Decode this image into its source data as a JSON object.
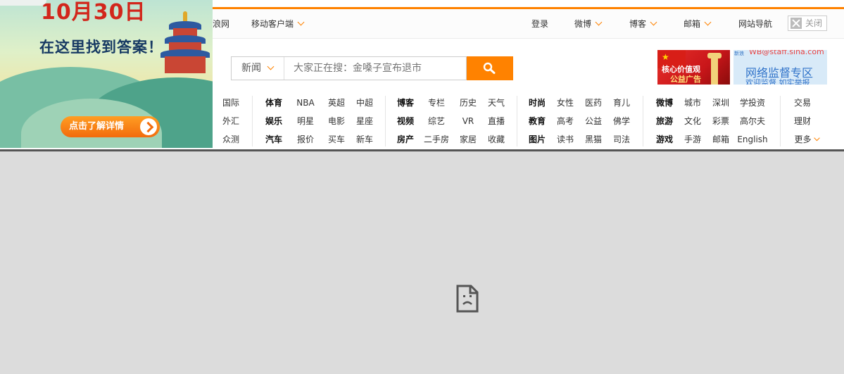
{
  "top_nav": {
    "site_partial": "浪网",
    "mobile_client": "移动客户端",
    "login": "登录",
    "weibo": "微博",
    "blog": "博客",
    "mail": "邮箱",
    "site_nav": "网站导航",
    "close": "关闭"
  },
  "search": {
    "category": "新闻",
    "placeholder": "大家正在搜：金嗓子宣布退市"
  },
  "ads": {
    "core_values_line1": "核心价值观",
    "core_values_line2": "公益广告",
    "monitor_email": "WB@staff.sina.com",
    "monitor_title": "网络监督专区",
    "monitor_sub": "欢迎监督 如实举报",
    "monitor_logo": "新浪"
  },
  "banner": {
    "title": "10月30日",
    "subtitle": "在这里找到答案！",
    "cta": "点击了解详情"
  },
  "link_groups": [
    {
      "col": [
        [
          "国际",
          "外汇",
          "众测"
        ]
      ]
    },
    {
      "cols": [
        [
          "体育",
          "娱乐",
          "汽车"
        ],
        [
          "NBA",
          "明星",
          "报价"
        ],
        [
          "英超",
          "电影",
          "买车"
        ],
        [
          "中超",
          "星座",
          "新车"
        ]
      ]
    },
    {
      "cols": [
        [
          "博客",
          "视频",
          "房产"
        ],
        [
          "专栏",
          "综艺",
          "二手房"
        ],
        [
          "历史",
          "VR",
          "家居"
        ],
        [
          "天气",
          "直播",
          "收藏"
        ]
      ]
    },
    {
      "cols": [
        [
          "时尚",
          "教育",
          "图片"
        ],
        [
          "女性",
          "高考",
          "读书"
        ],
        [
          "医药",
          "公益",
          "黑猫"
        ],
        [
          "育儿",
          "佛学",
          "司法"
        ]
      ]
    },
    {
      "cols": [
        [
          "微博",
          "旅游",
          "游戏"
        ],
        [
          "城市",
          "文化",
          "手游"
        ],
        [
          "深圳",
          "彩票",
          "邮箱"
        ],
        [
          "学投资",
          "高尔夫",
          "English"
        ]
      ]
    },
    {
      "col": [
        [
          "交易",
          "理财",
          "更多"
        ]
      ]
    }
  ],
  "links": {
    "g0": [
      "国际",
      "外汇",
      "众测"
    ],
    "g1c0": [
      "体育",
      "娱乐",
      "汽车"
    ],
    "g1c1": [
      "NBA",
      "明星",
      "报价"
    ],
    "g1c2": [
      "英超",
      "电影",
      "买车"
    ],
    "g1c3": [
      "中超",
      "星座",
      "新车"
    ],
    "g2c0": [
      "博客",
      "视频",
      "房产"
    ],
    "g2c1": [
      "专栏",
      "综艺",
      "二手房"
    ],
    "g2c2": [
      "历史",
      "VR",
      "家居"
    ],
    "g2c3": [
      "天气",
      "直播",
      "收藏"
    ],
    "g3c0": [
      "时尚",
      "教育",
      "图片"
    ],
    "g3c1": [
      "女性",
      "高考",
      "读书"
    ],
    "g3c2": [
      "医药",
      "公益",
      "黑猫"
    ],
    "g3c3": [
      "育儿",
      "佛学",
      "司法"
    ],
    "g4c0": [
      "微博",
      "旅游",
      "游戏"
    ],
    "g4c1": [
      "城市",
      "文化",
      "手游"
    ],
    "g4c2": [
      "深圳",
      "彩票",
      "邮箱"
    ],
    "g4c3": [
      "学投资",
      "高尔夫",
      "English"
    ],
    "g5": [
      "交易",
      "理财",
      "更多"
    ]
  },
  "colors": {
    "accent": "#ff8200",
    "crash_background": "#dcdcdc"
  },
  "icons": {
    "search_button": "search-icon",
    "crashed_frame": "sad-document-icon"
  }
}
